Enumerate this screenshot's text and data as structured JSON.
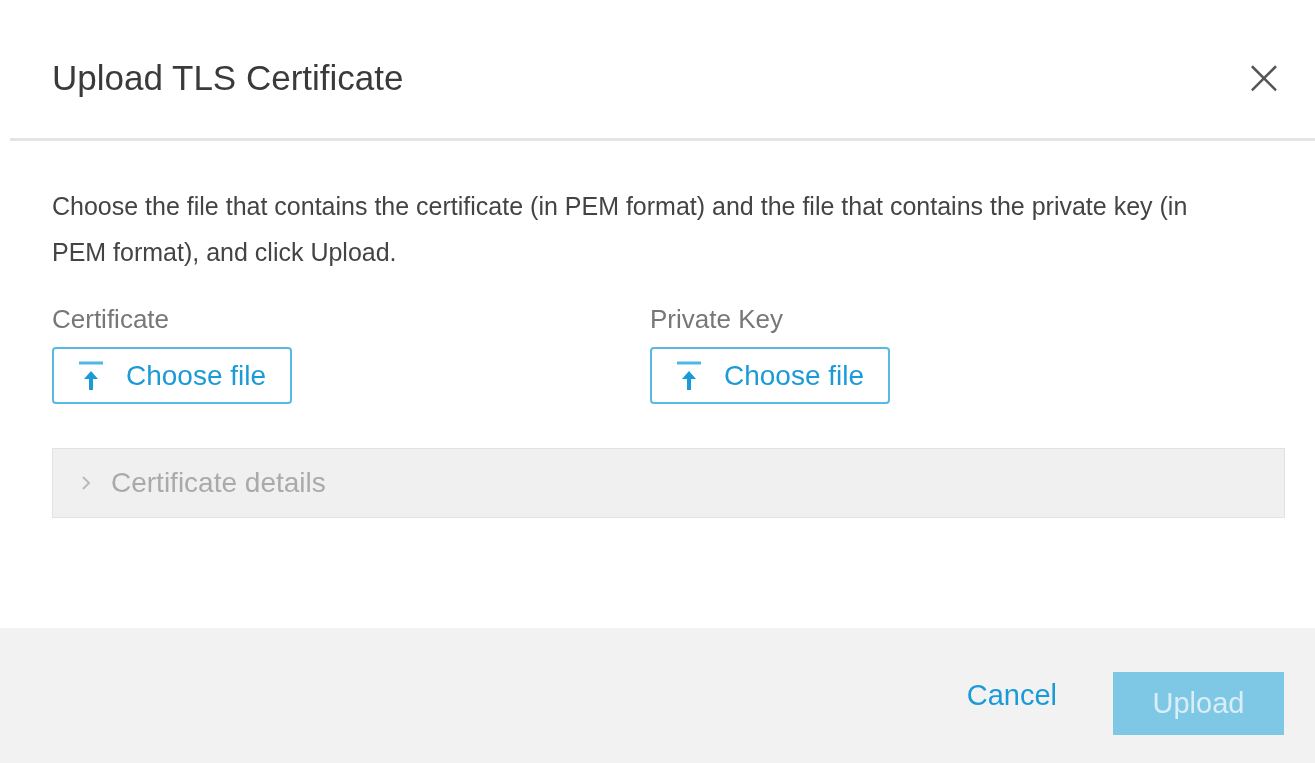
{
  "dialog": {
    "title": "Upload TLS Certificate",
    "close_icon": "×"
  },
  "description": "Choose the file that contains the certificate (in PEM format) and the file that contains the private key (in PEM format), and click Upload.",
  "file_fields": [
    {
      "label": "Certificate",
      "button": "Choose file"
    },
    {
      "label": "Private Key",
      "button": "Choose file"
    }
  ],
  "details": {
    "label": "Certificate details",
    "expanded": false
  },
  "footer": {
    "buttons": [
      {
        "label": "Cancel",
        "kind": "link",
        "disabled": false
      },
      {
        "label": "Upload",
        "kind": "primary",
        "disabled": true
      }
    ]
  }
}
